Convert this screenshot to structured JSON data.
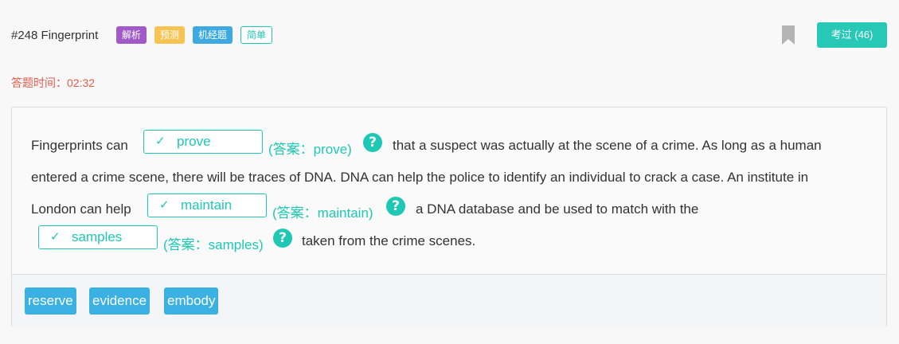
{
  "header": {
    "title": "#248 Fingerprint",
    "tags": [
      "解析",
      "预测",
      "机经题",
      "简单"
    ],
    "exam_button": "考过 (46)"
  },
  "timer": "答题时间：02:32",
  "passage": {
    "check_mark": "✓",
    "help_symbol": "?",
    "line1_before": "Fingerprints can",
    "blank1": {
      "value": "prove",
      "answer": "(答案：prove)"
    },
    "line1_after": "that a suspect was actually at the scene of a crime. As long as a human",
    "line2": "entered a crime scene, there will be traces of DNA. DNA can help the police to identify an individual to crack a case. An institute in",
    "line3_before": "London can help",
    "blank2": {
      "value": "maintain",
      "answer": "(答案：maintain)"
    },
    "line3_after": "a DNA database and be used to match with the",
    "blank3": {
      "value": "samples",
      "answer": "(答案：samples)"
    },
    "line4_after": "taken from the crime scenes."
  },
  "options": [
    "reserve",
    "evidence",
    "embody"
  ],
  "colors": {
    "accent": "#1ec8b4",
    "exam_button": "#27c9b6",
    "timer": "#e25c4d",
    "option_bg": "#3ab1e2"
  }
}
